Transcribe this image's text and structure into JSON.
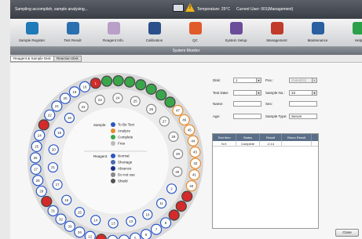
{
  "topbar": {
    "status": "Sampling accomplish, sample analysing...",
    "warning_glyph": "!",
    "temperature": "Temperature: 25°C",
    "current_user": "Current User: 001(Management)"
  },
  "toolbar": {
    "buttons": [
      {
        "label": "Sample Register",
        "icon": "gear-icon",
        "color": "#1e7ab8"
      },
      {
        "label": "Test Result",
        "icon": "tube-icon",
        "color": "#2a6fb0"
      },
      {
        "label": "Reagent Info.",
        "icon": "reagent-icon",
        "color": "#b8a0c8"
      },
      {
        "label": "Calibration",
        "icon": "gauge-icon",
        "color": "#2a4f8a"
      },
      {
        "label": "QC",
        "icon": "qc-icon",
        "color": "#e05a2a"
      },
      {
        "label": "System Setup",
        "icon": "tools-icon",
        "color": "#6a4c9a"
      },
      {
        "label": "Management",
        "icon": "users-icon",
        "color": "#c23a2a"
      },
      {
        "label": "Maintenance",
        "icon": "monitor-icon",
        "color": "#2a5fa0"
      },
      {
        "label": "Help",
        "icon": "help-icon",
        "color": "#2aa04a"
      }
    ]
  },
  "window_title": "System Monitor",
  "tabs": [
    "Reagent & Sample Disk",
    "Reaction Disk"
  ],
  "legend": {
    "sample_title": "Sample:",
    "sample_items": [
      {
        "label": "To Be Test",
        "color": "#2a56c6"
      },
      {
        "label": "Analyze",
        "color": "#e88a2a"
      },
      {
        "label": "Complete",
        "color": "#3aa64a"
      },
      {
        "label": "Free",
        "color": "#bbbbbb"
      }
    ],
    "reagent_title": "Reagent:",
    "reagent_items": [
      {
        "label": "Normal",
        "color": "#2a56c6"
      },
      {
        "label": "Shortage",
        "color": "#4a6ab0"
      },
      {
        "label": "Absence",
        "color": "#1a2e8a"
      },
      {
        "label": "Do not use",
        "color": "#888888"
      },
      {
        "label": "Shield",
        "color": "#555555"
      }
    ]
  },
  "outer_ring": [
    {
      "n": "1",
      "s": "red"
    },
    {
      "n": "",
      "s": "green"
    },
    {
      "n": "",
      "s": "green"
    },
    {
      "n": "",
      "s": "green"
    },
    {
      "n": "",
      "s": "green"
    },
    {
      "n": "",
      "s": "green"
    },
    {
      "n": "",
      "s": "green"
    },
    {
      "n": "",
      "s": "green"
    },
    {
      "n": "47",
      "s": "orange"
    },
    {
      "n": "46",
      "s": "orange"
    },
    {
      "n": "45",
      "s": "orange"
    },
    {
      "n": "44",
      "s": "orange"
    },
    {
      "n": "43",
      "s": "orange"
    },
    {
      "n": "42",
      "s": "orange"
    },
    {
      "n": "41",
      "s": "orange"
    },
    {
      "n": "40",
      "s": "orange"
    },
    {
      "n": "",
      "s": "red"
    },
    {
      "n": "",
      "s": "red"
    },
    {
      "n": "",
      "s": "red"
    },
    {
      "n": "8",
      "s": "blue"
    },
    {
      "n": "7",
      "s": "blue"
    },
    {
      "n": "6",
      "s": "blue"
    },
    {
      "n": "5",
      "s": "blue"
    },
    {
      "n": "4",
      "s": "blue"
    },
    {
      "n": "3",
      "s": "blue"
    },
    {
      "n": "",
      "s": "red"
    },
    {
      "n": "12",
      "s": "blue"
    },
    {
      "n": "34",
      "s": "blue"
    },
    {
      "n": "33",
      "s": "blue"
    },
    {
      "n": "32",
      "s": "blue"
    },
    {
      "n": "31",
      "s": "blue"
    },
    {
      "n": "",
      "s": "red"
    },
    {
      "n": "29",
      "s": "blue"
    },
    {
      "n": "28",
      "s": "blue"
    },
    {
      "n": "27",
      "s": "blue"
    },
    {
      "n": "26",
      "s": "blue"
    },
    {
      "n": "25",
      "s": "blue"
    },
    {
      "n": "24",
      "s": "blue"
    },
    {
      "n": "",
      "s": "red"
    },
    {
      "n": "22",
      "s": "blue"
    },
    {
      "n": "21",
      "s": "blue"
    },
    {
      "n": "20",
      "s": "blue"
    },
    {
      "n": "19",
      "s": "blue"
    },
    {
      "n": "18",
      "s": "blue"
    }
  ],
  "inner_ring": [
    {
      "n": "23",
      "s": "grey"
    },
    {
      "n": "24",
      "s": "grey"
    },
    {
      "n": "25",
      "s": "grey"
    },
    {
      "n": "26",
      "s": "grey"
    },
    {
      "n": "27",
      "s": "grey"
    },
    {
      "n": "28",
      "s": "grey"
    },
    {
      "n": "29",
      "s": "grey"
    },
    {
      "n": "30",
      "s": "grey"
    },
    {
      "n": "2",
      "s": "blue"
    },
    {
      "n": "11",
      "s": "blue"
    },
    {
      "n": "10",
      "s": "blue"
    },
    {
      "n": "12",
      "s": "blue"
    },
    {
      "n": "13",
      "s": "blue"
    },
    {
      "n": "14",
      "s": "blue"
    },
    {
      "n": "15",
      "s": "blue"
    },
    {
      "n": "16",
      "s": "blue"
    },
    {
      "n": "17",
      "s": "blue"
    },
    {
      "n": "21",
      "s": "blue"
    },
    {
      "n": "20",
      "s": "blue"
    },
    {
      "n": "19",
      "s": "blue"
    },
    {
      "n": "18",
      "s": "blue"
    },
    {
      "n": "22",
      "s": "grey"
    }
  ],
  "form": {
    "disk_label": "Disk:",
    "disk_value": "1",
    "pos_label": "Pos.:",
    "pos_value": "Outer[03]",
    "test_date_label": "Test Date:",
    "test_date_value": "",
    "sample_no_label": "Sample No.:",
    "sample_no_value": "33",
    "name_label": "Name:",
    "name_value": "",
    "sex_label": "Sex:",
    "sex_value": "",
    "age_label": "Age:",
    "age_value": "",
    "sample_type_label": "Sample Type:",
    "sample_type_value": "Serum"
  },
  "table": {
    "headers": [
      "Test Item",
      "Status",
      "Result",
      "Rerun Result"
    ],
    "rows": [
      [
        "N.K",
        "Complete",
        "-0.14",
        ""
      ]
    ]
  },
  "close_label": "Close"
}
